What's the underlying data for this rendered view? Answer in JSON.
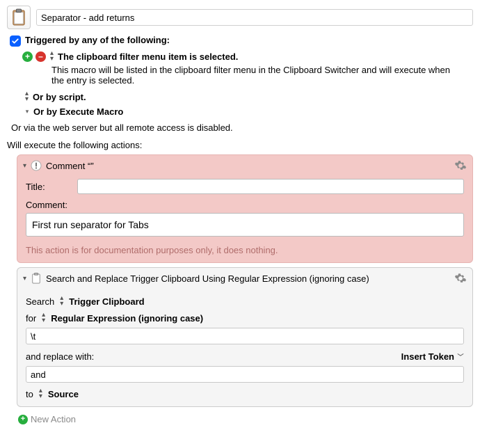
{
  "header": {
    "macro_name": "Separator - add returns"
  },
  "triggers": {
    "enabled_label": "Triggered by any of the following:",
    "trigger_text": "The clipboard filter menu item is selected.",
    "description": "This macro will be listed in the clipboard filter menu in the Clipboard Switcher and will execute when the entry is selected.",
    "or_script": "Or by script.",
    "or_execute_macro": "Or by Execute Macro",
    "or_web": "Or via the web server but all remote access is disabled."
  },
  "actions_label": "Will execute the following actions:",
  "actions": {
    "comment": {
      "header": "Comment “”",
      "title_label": "Title:",
      "title_value": "",
      "comment_label": "Comment:",
      "comment_value": "First run separator for Tabs",
      "hint": "This action is for documentation purposes only, it does nothing."
    },
    "search_replace": {
      "header": "Search and Replace Trigger Clipboard Using Regular Expression (ignoring case)",
      "search_label": "Search",
      "search_target": "Trigger Clipboard",
      "for_label": "for",
      "for_mode": "Regular Expression (ignoring case)",
      "search_value": "\\t",
      "replace_label": "and replace with:",
      "insert_token": "Insert Token",
      "replace_value": "and",
      "to_label": "to",
      "to_target": "Source"
    }
  },
  "footer": {
    "new_action": "New Action"
  }
}
